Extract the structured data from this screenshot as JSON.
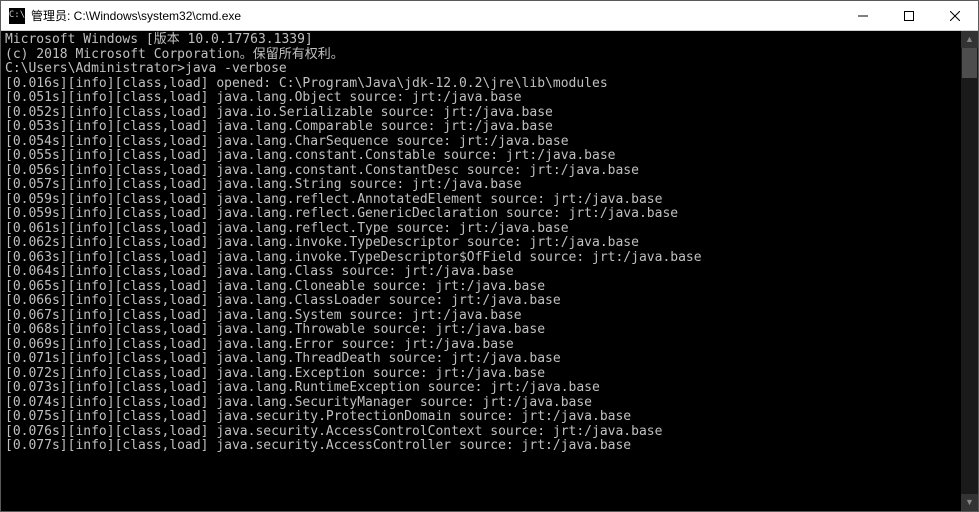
{
  "window": {
    "title": "管理员: C:\\Windows\\system32\\cmd.exe",
    "icon_label": "cmd-icon",
    "icon_glyph": "C:\\"
  },
  "banner": {
    "line1": "Microsoft Windows [版本 10.0.17763.1339]",
    "line2": "(c) 2018 Microsoft Corporation。保留所有权利。"
  },
  "prompt": {
    "cwd": "C:\\Users\\Administrator>",
    "command": "java -verbose"
  },
  "log_lines": [
    {
      "time": "0.016s",
      "level": "info",
      "tag": "class,load",
      "msg": "opened: C:\\Program\\Java\\jdk-12.0.2\\jre\\lib\\modules"
    },
    {
      "time": "0.051s",
      "level": "info",
      "tag": "class,load",
      "msg": "java.lang.Object source: jrt:/java.base"
    },
    {
      "time": "0.052s",
      "level": "info",
      "tag": "class,load",
      "msg": "java.io.Serializable source: jrt:/java.base"
    },
    {
      "time": "0.053s",
      "level": "info",
      "tag": "class,load",
      "msg": "java.lang.Comparable source: jrt:/java.base"
    },
    {
      "time": "0.054s",
      "level": "info",
      "tag": "class,load",
      "msg": "java.lang.CharSequence source: jrt:/java.base"
    },
    {
      "time": "0.055s",
      "level": "info",
      "tag": "class,load",
      "msg": "java.lang.constant.Constable source: jrt:/java.base"
    },
    {
      "time": "0.056s",
      "level": "info",
      "tag": "class,load",
      "msg": "java.lang.constant.ConstantDesc source: jrt:/java.base"
    },
    {
      "time": "0.057s",
      "level": "info",
      "tag": "class,load",
      "msg": "java.lang.String source: jrt:/java.base"
    },
    {
      "time": "0.059s",
      "level": "info",
      "tag": "class,load",
      "msg": "java.lang.reflect.AnnotatedElement source: jrt:/java.base"
    },
    {
      "time": "0.059s",
      "level": "info",
      "tag": "class,load",
      "msg": "java.lang.reflect.GenericDeclaration source: jrt:/java.base"
    },
    {
      "time": "0.061s",
      "level": "info",
      "tag": "class,load",
      "msg": "java.lang.reflect.Type source: jrt:/java.base"
    },
    {
      "time": "0.062s",
      "level": "info",
      "tag": "class,load",
      "msg": "java.lang.invoke.TypeDescriptor source: jrt:/java.base"
    },
    {
      "time": "0.063s",
      "level": "info",
      "tag": "class,load",
      "msg": "java.lang.invoke.TypeDescriptor$OfField source: jrt:/java.base"
    },
    {
      "time": "0.064s",
      "level": "info",
      "tag": "class,load",
      "msg": "java.lang.Class source: jrt:/java.base"
    },
    {
      "time": "0.065s",
      "level": "info",
      "tag": "class,load",
      "msg": "java.lang.Cloneable source: jrt:/java.base"
    },
    {
      "time": "0.066s",
      "level": "info",
      "tag": "class,load",
      "msg": "java.lang.ClassLoader source: jrt:/java.base"
    },
    {
      "time": "0.067s",
      "level": "info",
      "tag": "class,load",
      "msg": "java.lang.System source: jrt:/java.base"
    },
    {
      "time": "0.068s",
      "level": "info",
      "tag": "class,load",
      "msg": "java.lang.Throwable source: jrt:/java.base"
    },
    {
      "time": "0.069s",
      "level": "info",
      "tag": "class,load",
      "msg": "java.lang.Error source: jrt:/java.base"
    },
    {
      "time": "0.071s",
      "level": "info",
      "tag": "class,load",
      "msg": "java.lang.ThreadDeath source: jrt:/java.base"
    },
    {
      "time": "0.072s",
      "level": "info",
      "tag": "class,load",
      "msg": "java.lang.Exception source: jrt:/java.base"
    },
    {
      "time": "0.073s",
      "level": "info",
      "tag": "class,load",
      "msg": "java.lang.RuntimeException source: jrt:/java.base"
    },
    {
      "time": "0.074s",
      "level": "info",
      "tag": "class,load",
      "msg": "java.lang.SecurityManager source: jrt:/java.base"
    },
    {
      "time": "0.075s",
      "level": "info",
      "tag": "class,load",
      "msg": "java.security.ProtectionDomain source: jrt:/java.base"
    },
    {
      "time": "0.076s",
      "level": "info",
      "tag": "class,load",
      "msg": "java.security.AccessControlContext source: jrt:/java.base"
    },
    {
      "time": "0.077s",
      "level": "info",
      "tag": "class,load",
      "msg": "java.security.AccessController source: jrt:/java.base"
    }
  ]
}
